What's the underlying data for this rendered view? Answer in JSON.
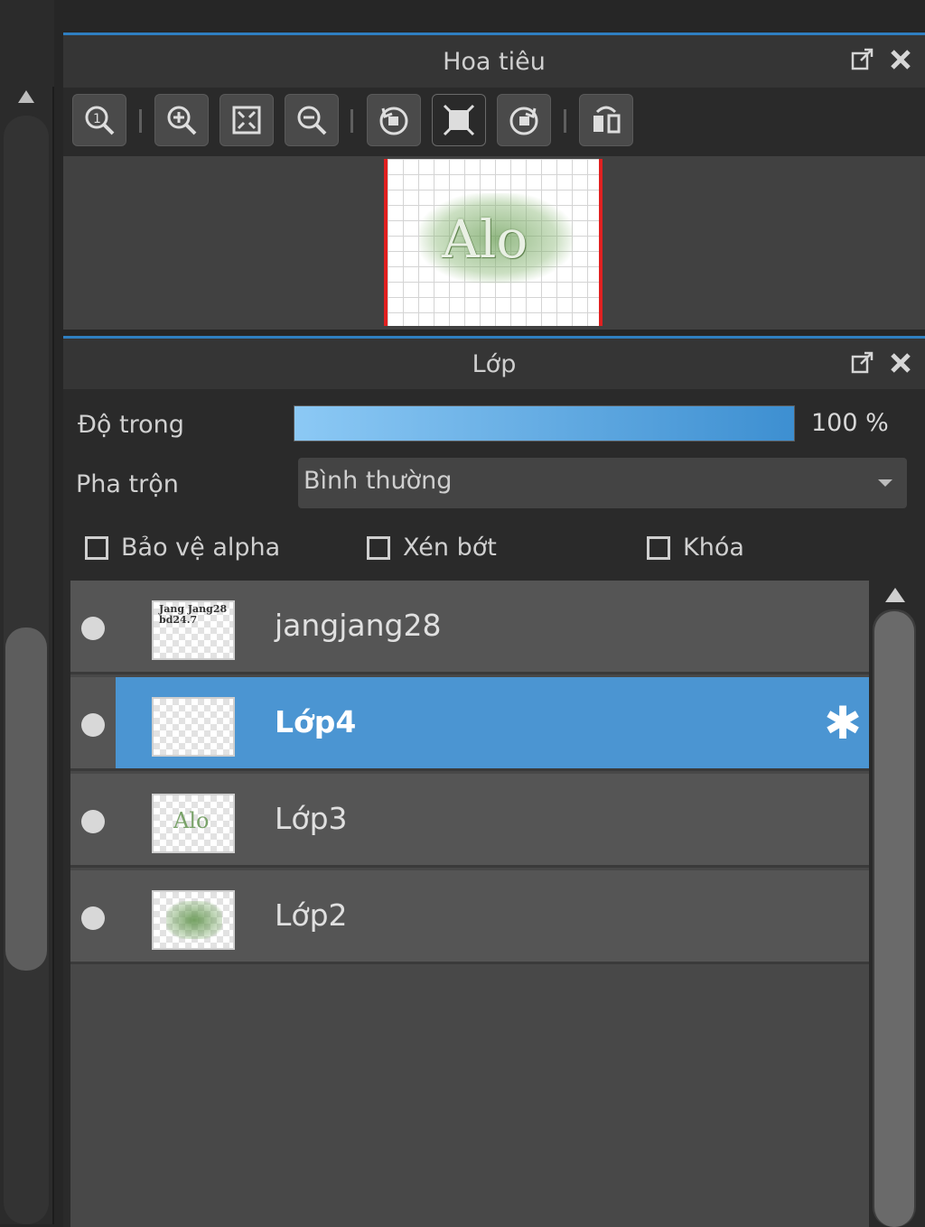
{
  "navigator": {
    "title": "Hoa tiêu",
    "toolbar": [
      "zoom-actual-icon",
      "zoom-in-icon",
      "fit-window-icon",
      "zoom-out-icon",
      "rotate-left-icon",
      "fit-screen-icon",
      "rotate-right-icon",
      "flip-horizontal-icon"
    ],
    "preview_text": "Alo"
  },
  "layers_panel": {
    "title": "Lớp",
    "opacity_label": "Độ trong",
    "opacity_value": "100 %",
    "opacity_fraction": 1.0,
    "blend_label": "Pha trộn",
    "blend_value": "Bình thường",
    "checks": {
      "protect_alpha": "Bảo vệ alpha",
      "clipping": "Xén bớt",
      "lock": "Khóa"
    },
    "layers": [
      {
        "name": "jangjang28",
        "thumb_text": "Jang Jang28 bd24.7",
        "selected": false
      },
      {
        "name": "Lớp4",
        "selected": true
      },
      {
        "name": "Lớp3",
        "thumb_text": "Alo",
        "selected": false
      },
      {
        "name": "Lớp2",
        "selected": false
      }
    ]
  },
  "colors": {
    "accent": "#4b95d2",
    "panel_border": "#2f7fc1",
    "preview_border": "#e02020"
  }
}
